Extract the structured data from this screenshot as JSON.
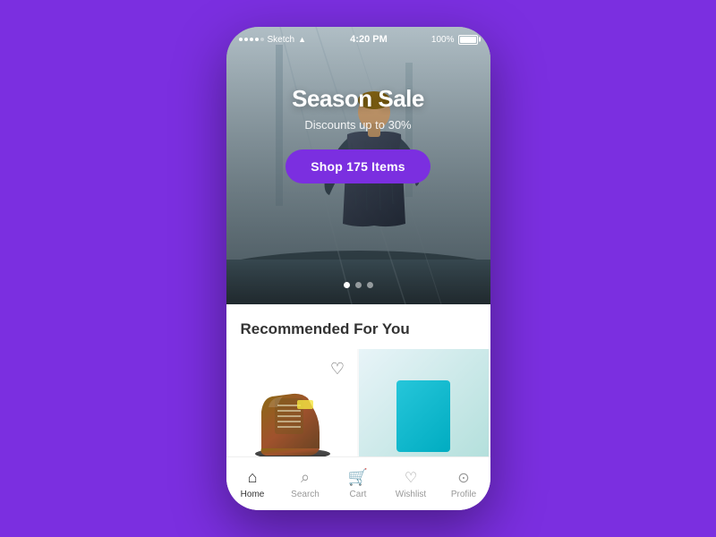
{
  "statusBar": {
    "carrier": "Sketch",
    "time": "4:20 PM",
    "battery": "100%"
  },
  "hero": {
    "title": "Season Sale",
    "subtitle": "Discounts up to 30%",
    "ctaLabel": "Shop 175 Items",
    "carouselDots": [
      true,
      false,
      false
    ]
  },
  "recommended": {
    "sectionTitle": "Recommended For You"
  },
  "nav": {
    "items": [
      {
        "label": "Home",
        "icon": "🏠",
        "active": true
      },
      {
        "label": "Search",
        "icon": "🔍",
        "active": false
      },
      {
        "label": "Cart",
        "icon": "🛒",
        "active": false
      },
      {
        "label": "Wishlist",
        "icon": "♡",
        "active": false
      },
      {
        "label": "Profile",
        "icon": "👤",
        "active": false
      }
    ]
  }
}
